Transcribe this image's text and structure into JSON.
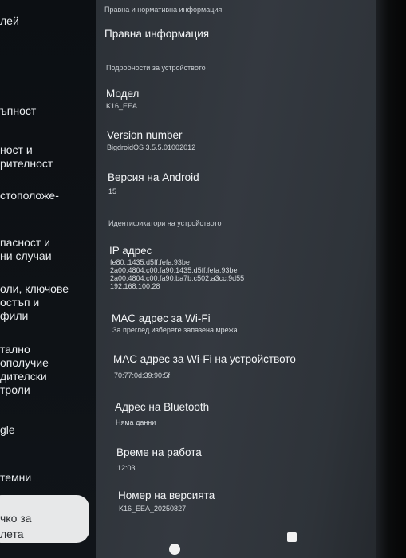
{
  "sidebar": {
    "items": [
      {
        "lines": [
          "лей"
        ]
      },
      {
        "lines": [
          "ъпност"
        ]
      },
      {
        "lines": [
          "ност и",
          "рителност"
        ]
      },
      {
        "lines": [
          "стоположе-"
        ]
      },
      {
        "lines": [
          "пасност и",
          "ни случаи"
        ]
      },
      {
        "lines": [
          "оли, ключове",
          "остъп и",
          "фили"
        ]
      },
      {
        "lines": [
          "тално",
          "ополучие",
          "дителски",
          "троли"
        ]
      },
      {
        "lines": [
          "gle"
        ]
      },
      {
        "lines": [
          "темни"
        ]
      }
    ],
    "search": {
      "line1": "чко за",
      "line2": "лета"
    }
  },
  "content": {
    "legal_section": "Правна и нормативна информация",
    "legal_info": "Правна информация",
    "device_details_section": "Подробности за устройството",
    "model": {
      "title": "Модел",
      "value": "K16_EEA"
    },
    "version_number": {
      "title": "Version number",
      "value": "BigdroidOS 3.5.5.01002012"
    },
    "android_version": {
      "title": "Версия на Android",
      "value": "15"
    },
    "identifiers_section": "Идентификатори на устройството",
    "ip_address": {
      "title": "IP адрес",
      "values": [
        "fe80::1435:d5ff:fefa:93be",
        "2a00:4804:c00:fa90:1435:d5ff:fefa:93be",
        "2a00:4804:c00:fa90:ba7b:c502:a3cc:9d55",
        "192.168.100.28"
      ]
    },
    "wifi_mac": {
      "title": "MAC адрес за Wi-Fi",
      "value": "За преглед изберете запазена мрежа"
    },
    "device_wifi_mac": {
      "title": "MAC адрес за Wi-Fi на устройството",
      "value": "70:77:0d:39:90:5f"
    },
    "bluetooth": {
      "title": "Адрес на Bluetooth",
      "value": "Няма данни"
    },
    "uptime": {
      "title": "Време на работа",
      "value": "12:03"
    },
    "build_number": {
      "title": "Номер на версията",
      "value": "K16_EEA_20250827"
    }
  },
  "navbar": {
    "home_icon": "circle-home-icon",
    "recents_icon": "square-recents-icon"
  }
}
